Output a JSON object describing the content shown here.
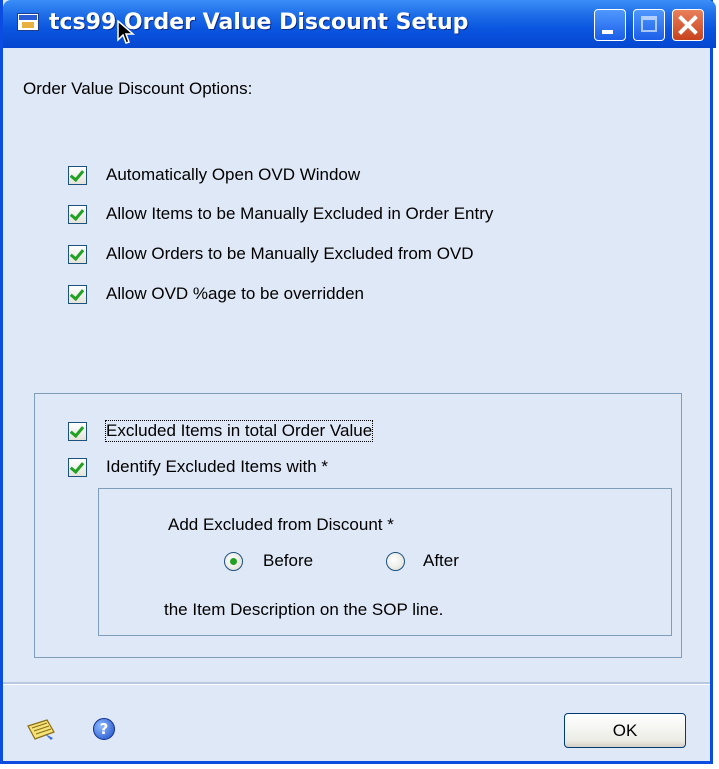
{
  "window": {
    "title": "tcs99 Order Value Discount Setup"
  },
  "options_label": "Order Value Discount Options:",
  "checkboxes_top": [
    {
      "label": "Automatically Open OVD Window",
      "checked": true
    },
    {
      "label": "Allow Items to be Manually Excluded in Order Entry",
      "checked": true
    },
    {
      "label": "Allow Orders to be Manually Excluded from OVD",
      "checked": true
    },
    {
      "label": "Allow OVD %age to be overridden",
      "checked": true
    }
  ],
  "group": {
    "checkboxes": [
      {
        "label": "Excluded Items in total Order Value",
        "checked": true
      },
      {
        "label": "Identify Excluded Items with *",
        "checked": true
      }
    ],
    "subgroup": {
      "add_label": "Add Excluded from Discount *",
      "radio_options": [
        {
          "label": "Before",
          "selected": true
        },
        {
          "label": "After",
          "selected": false
        }
      ],
      "description": "the Item Description on the SOP line."
    }
  },
  "footer": {
    "ok_label": "OK",
    "note_icon": "note-icon",
    "help_icon": "help-icon"
  },
  "colors": {
    "title_bar": "#0a55e0",
    "window_background": "#dfe8f6",
    "check_green": "#21a121"
  }
}
